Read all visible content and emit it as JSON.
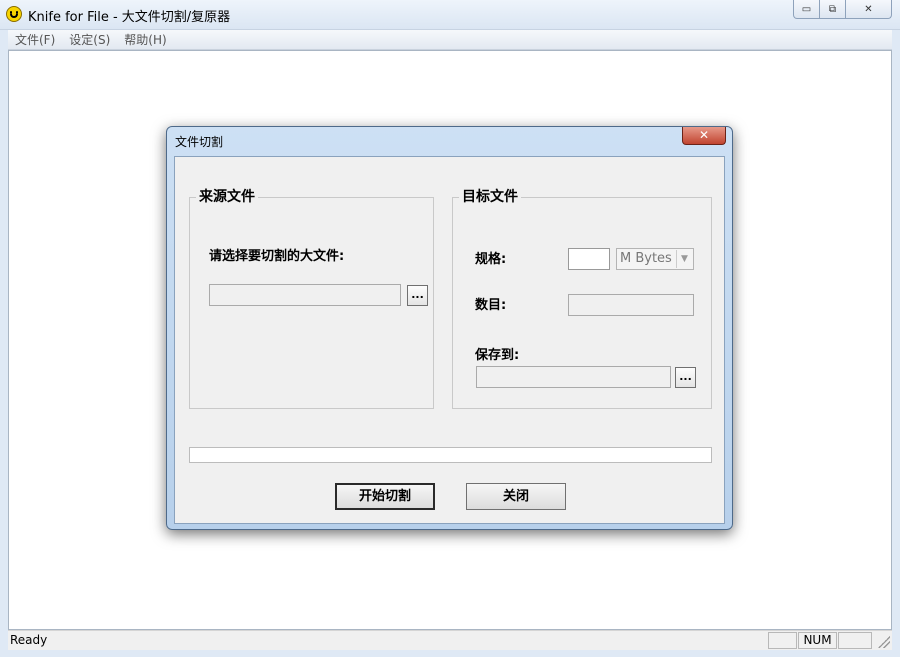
{
  "window": {
    "title": "Knife for File - 大文件切割/复原器",
    "controls": {
      "minimize": "▭",
      "maximize": "⧉",
      "close": "✕"
    }
  },
  "menu": [
    {
      "label": "文件(F)"
    },
    {
      "label": "设定(S)"
    },
    {
      "label": "帮助(H)"
    }
  ],
  "status": {
    "text": "Ready",
    "panes": [
      "",
      "NUM",
      ""
    ]
  },
  "dialog": {
    "title": "文件切割",
    "close_glyph": "✕",
    "source_group": {
      "title": "来源文件",
      "prompt": "请选择要切割的大文件:",
      "path_value": "",
      "browse_label": "..."
    },
    "target_group": {
      "title": "目标文件",
      "size_label": "规格:",
      "size_value": "",
      "unit_selected": "M Bytes",
      "count_label": "数目:",
      "count_value": "",
      "save_label": "保存到:",
      "save_value": "",
      "browse_label": "..."
    },
    "progress_fraction": 0,
    "buttons": {
      "start": "开始切割",
      "close": "关闭"
    }
  },
  "icons": {
    "app": "smiley-icon",
    "dropdown": "chevron-down-icon"
  }
}
